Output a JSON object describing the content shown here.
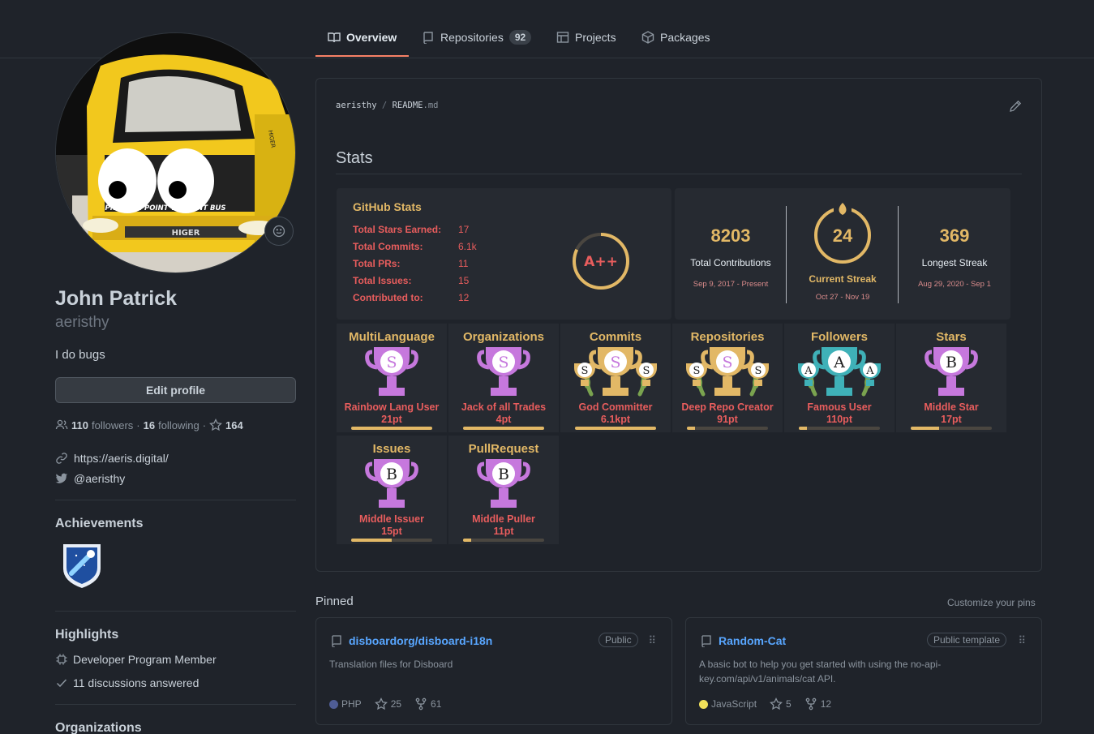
{
  "nav": {
    "tabs": [
      {
        "label": "Overview",
        "icon": "book-icon"
      },
      {
        "label": "Repositories",
        "icon": "repo-icon",
        "count": "92"
      },
      {
        "label": "Projects",
        "icon": "table-icon"
      },
      {
        "label": "Packages",
        "icon": "package-icon"
      }
    ]
  },
  "profile": {
    "name": "John Patrick",
    "login": "aeristhy",
    "bio": "I do bugs",
    "edit_label": "Edit profile",
    "followers": "110",
    "followers_label": "followers",
    "following": "16",
    "following_label": "following",
    "stars": "164",
    "website": "https://aeris.digital/",
    "twitter": "@aeristhy",
    "avatar_bus_text": "PREMIUM POINT TO POINT BUS",
    "avatar_brand": "HIGER"
  },
  "achievements": {
    "title": "Achievements"
  },
  "highlights": {
    "title": "Highlights",
    "items": [
      "Developer Program Member",
      "11 discussions answered"
    ]
  },
  "organizations": {
    "title": "Organizations"
  },
  "readme": {
    "owner": "aeristhy",
    "sep": "/",
    "file": "README",
    "ext": ".md",
    "heading": "Stats"
  },
  "github_stats": {
    "title": "GitHub Stats",
    "rows": [
      {
        "label": "Total Stars Earned:",
        "value": "17"
      },
      {
        "label": "Total Commits:",
        "value": "6.1k"
      },
      {
        "label": "Total PRs:",
        "value": "11"
      },
      {
        "label": "Total Issues:",
        "value": "15"
      },
      {
        "label": "Contributed to:",
        "value": "12"
      }
    ],
    "grade": "A++"
  },
  "streak": {
    "total": {
      "value": "8203",
      "label": "Total Contributions",
      "range": "Sep 9, 2017 - Present"
    },
    "current": {
      "value": "24",
      "label": "Current Streak",
      "range": "Oct 27 - Nov 19"
    },
    "longest": {
      "value": "369",
      "label": "Longest Streak",
      "range": "Aug 29, 2020 - Sep 1"
    }
  },
  "trophies": [
    {
      "title": "MultiLanguage",
      "rank": "S",
      "name": "Rainbow Lang User",
      "points": "21pt",
      "progress": 1.0,
      "color": "#c678dd",
      "laurel": false,
      "sub": false
    },
    {
      "title": "Organizations",
      "rank": "S",
      "name": "Jack of all Trades",
      "points": "4pt",
      "progress": 1.0,
      "color": "#c678dd",
      "laurel": false,
      "sub": false
    },
    {
      "title": "Commits",
      "rank": "S",
      "sub_rank": "S",
      "name": "God Committer",
      "points": "6.1kpt",
      "progress": 1.0,
      "color": "#e2b866",
      "laurel": true,
      "sub": true
    },
    {
      "title": "Repositories",
      "rank": "S",
      "sub_rank": "S",
      "name": "Deep Repo Creator",
      "points": "91pt",
      "progress": 0.1,
      "color": "#e2b866",
      "laurel": true,
      "sub": true
    },
    {
      "title": "Followers",
      "rank": "A",
      "sub_rank": "A",
      "name": "Famous User",
      "points": "110pt",
      "progress": 0.1,
      "color": "#3fb1b8",
      "laurel": true,
      "sub": true
    },
    {
      "title": "Stars",
      "rank": "B",
      "name": "Middle Star",
      "points": "17pt",
      "progress": 0.35,
      "color": "#c678dd",
      "laurel": false,
      "sub": false
    },
    {
      "title": "Issues",
      "rank": "B",
      "name": "Middle Issuer",
      "points": "15pt",
      "progress": 0.5,
      "color": "#c678dd",
      "laurel": false,
      "sub": false
    },
    {
      "title": "PullRequest",
      "rank": "B",
      "name": "Middle Puller",
      "points": "11pt",
      "progress": 0.1,
      "color": "#c678dd",
      "laurel": false,
      "sub": false
    }
  ],
  "pinned": {
    "title": "Pinned",
    "customize": "Customize your pins",
    "repos": [
      {
        "name": "disboardorg/disboard-i18n",
        "badge": "Public",
        "desc": "Translation files for Disboard",
        "lang": "PHP",
        "lang_color": "#4f5d95",
        "stars": "25",
        "forks": "61"
      },
      {
        "name": "Random-Cat",
        "badge": "Public template",
        "desc": "A basic bot to help you get started with using the no-api-key.com/api/v1/animals/cat API.",
        "lang": "JavaScript",
        "lang_color": "#f1e05a",
        "stars": "5",
        "forks": "12"
      }
    ]
  }
}
